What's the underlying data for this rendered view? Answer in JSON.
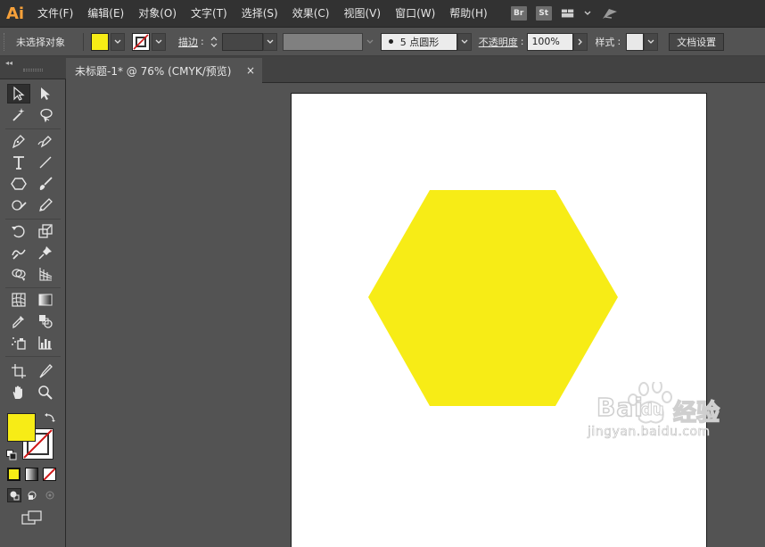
{
  "app": {
    "logo": "Ai"
  },
  "menu": {
    "items": [
      "文件(F)",
      "编辑(E)",
      "对象(O)",
      "文字(T)",
      "选择(S)",
      "效果(C)",
      "视图(V)",
      "窗口(W)",
      "帮助(H)"
    ],
    "bridge_badge": "Br",
    "stock_badge": "St"
  },
  "control": {
    "selection_status": "未选择对象",
    "stroke_label": "描边",
    "brush_value": "5 点圆形",
    "opacity_label": "不透明度",
    "opacity_value": "100%",
    "style_label": "样式",
    "doc_settings_button": "文档设置",
    "fill_color": "#f7ec16"
  },
  "document": {
    "tab_title": "未标题-1* @ 76% (CMYK/预览)",
    "close_glyph": "×"
  },
  "artwork": {
    "shape": "hexagon",
    "fill": "#f7ec16"
  },
  "watermark": {
    "brand": "Bai",
    "brand_suffix": "du",
    "product": "经验",
    "url": "jingyan.baidu.com"
  },
  "colors": {
    "fill": "#f7ec16",
    "accent_logo": "#f7a13a"
  }
}
